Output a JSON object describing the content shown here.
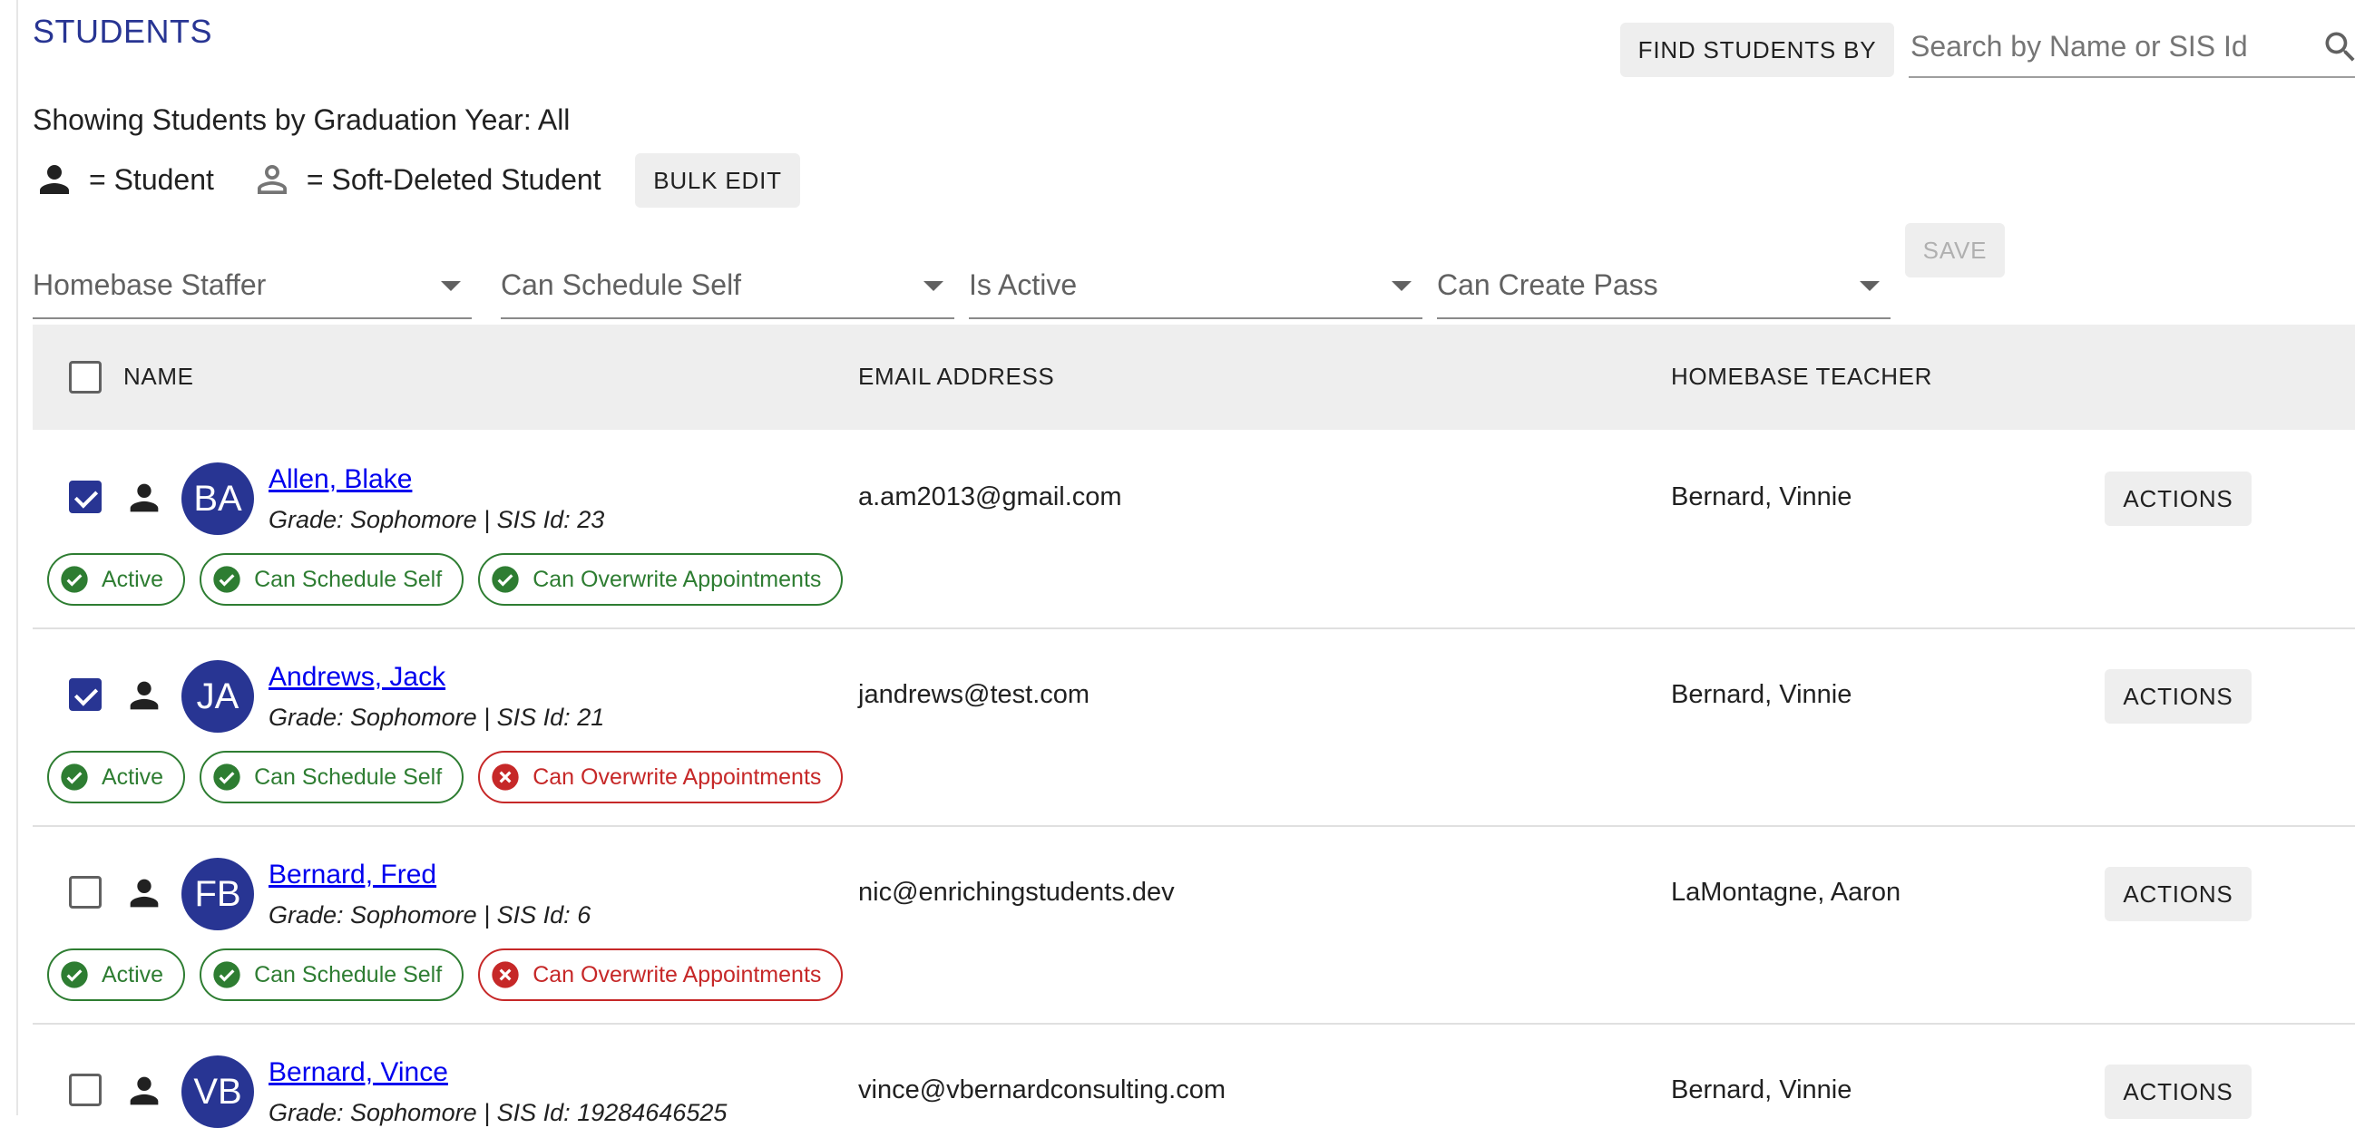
{
  "page": {
    "title": "STUDENTS",
    "subtitle": "Showing Students by Graduation Year: All"
  },
  "search": {
    "find_by_label": "FIND STUDENTS BY",
    "placeholder": "Search by Name or SIS Id",
    "value": ""
  },
  "legend": {
    "student_label": "= Student",
    "soft_deleted_label": "= Soft-Deleted Student",
    "student_icon": "person-icon",
    "soft_deleted_icon": "person-outline-icon"
  },
  "bulk_edit_label": "BULK EDIT",
  "filters": [
    {
      "label": "Homebase Staffer"
    },
    {
      "label": "Can Schedule Self"
    },
    {
      "label": "Is Active"
    },
    {
      "label": "Can Create Pass"
    }
  ],
  "save_label": "SAVE",
  "table": {
    "columns": {
      "name": "NAME",
      "email": "EMAIL ADDRESS",
      "teacher": "HOMEBASE TEACHER"
    },
    "actions_label": "ACTIONS",
    "rows": [
      {
        "initials": "BA",
        "name": "Allen, Blake",
        "detail": "Grade: Sophomore  |  SIS Id: 23",
        "email": "a.am2013@gmail.com",
        "teacher": "Bernard, Vinnie",
        "checked": true,
        "chips": [
          {
            "label": "Active",
            "ok": true
          },
          {
            "label": "Can Schedule Self",
            "ok": true
          },
          {
            "label": "Can Overwrite Appointments",
            "ok": true
          }
        ]
      },
      {
        "initials": "JA",
        "name": "Andrews, Jack",
        "detail": "Grade: Sophomore  |  SIS Id: 21",
        "email": "jandrews@test.com",
        "teacher": "Bernard, Vinnie",
        "checked": true,
        "chips": [
          {
            "label": "Active",
            "ok": true
          },
          {
            "label": "Can Schedule Self",
            "ok": true
          },
          {
            "label": "Can Overwrite Appointments",
            "ok": false
          }
        ]
      },
      {
        "initials": "FB",
        "name": "Bernard, Fred",
        "detail": "Grade: Sophomore  |  SIS Id: 6",
        "email": "nic@enrichingstudents.dev",
        "teacher": "LaMontagne, Aaron",
        "checked": false,
        "chips": [
          {
            "label": "Active",
            "ok": true
          },
          {
            "label": "Can Schedule Self",
            "ok": true
          },
          {
            "label": "Can Overwrite Appointments",
            "ok": false
          }
        ]
      },
      {
        "initials": "VB",
        "name": "Bernard, Vince",
        "detail": "Grade: Sophomore  |  SIS Id: 19284646525",
        "email": "vince@vbernardconsulting.com",
        "teacher": "Bernard, Vinnie",
        "checked": false,
        "chips": []
      }
    ]
  },
  "colors": {
    "primary": "#283593",
    "success": "#2e7d32",
    "error": "#c62828",
    "link": "#0000ee"
  }
}
